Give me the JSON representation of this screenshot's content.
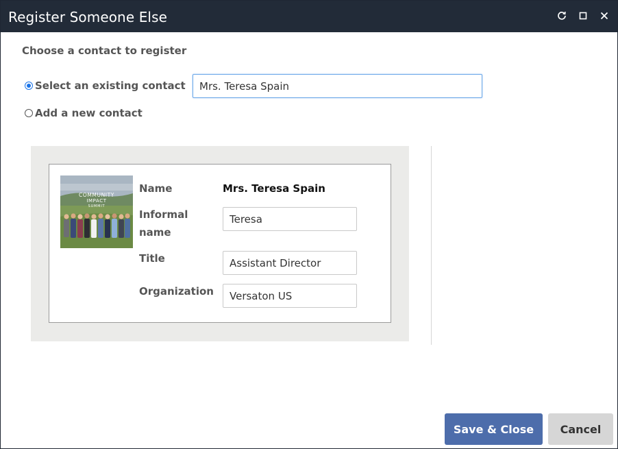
{
  "window": {
    "title": "Register Someone Else"
  },
  "form": {
    "heading": "Choose a contact to register",
    "options": [
      {
        "label": "Select an existing contact",
        "checked": true
      },
      {
        "label": "Add a new contact",
        "checked": false
      }
    ],
    "contact_search_value": "Mrs. Teresa Spain"
  },
  "contact_card": {
    "photo_caption_line1": "COMMUNITY",
    "photo_caption_line2": "IMPACT",
    "photo_caption_line3": "SUMMIT",
    "name_label": "Name",
    "name_value": "Mrs. Teresa Spain",
    "informal_label": "Informal name",
    "informal_value": "Teresa",
    "title_label": "Title",
    "title_value": "Assistant Director",
    "organization_label": "Organization",
    "organization_value": "Versaton US"
  },
  "footer": {
    "save_label": "Save & Close",
    "cancel_label": "Cancel"
  },
  "colors": {
    "titlebar": "#222b38",
    "primary_button": "#4d6dab",
    "secondary_button": "#d6d6d6",
    "radio_accent": "#1a73e8"
  }
}
